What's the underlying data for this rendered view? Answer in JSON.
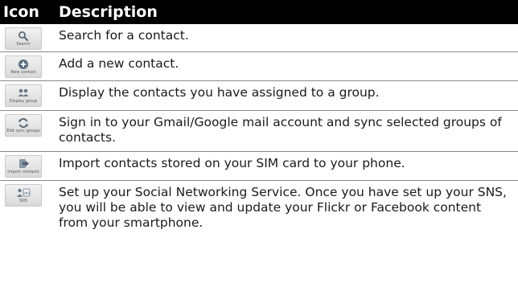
{
  "header": {
    "icon_col": "Icon",
    "description_col": "Description"
  },
  "rows": [
    {
      "icon_name": "search-icon",
      "icon_caption": "Search",
      "description": "Search for a contact."
    },
    {
      "icon_name": "new-contact-icon",
      "icon_caption": "New contact",
      "description": "Add a new contact."
    },
    {
      "icon_name": "display-group-icon",
      "icon_caption": "Display group",
      "description": "Display the contacts you have assigned to a group."
    },
    {
      "icon_name": "sync-icon",
      "icon_caption": "Edit sync groups",
      "description": "Sign in to your Gmail/Google mail account and sync selected groups of contacts."
    },
    {
      "icon_name": "import-contacts-icon",
      "icon_caption": "Import contacts",
      "description": "Import contacts stored on your SIM card to your phone."
    },
    {
      "icon_name": "sns-icon",
      "icon_caption": "SNS",
      "description": "Set up your Social Networking Service. Once you have set up your SNS, you will be able to view and update your Flickr or Facebook content from your smartphone."
    }
  ]
}
